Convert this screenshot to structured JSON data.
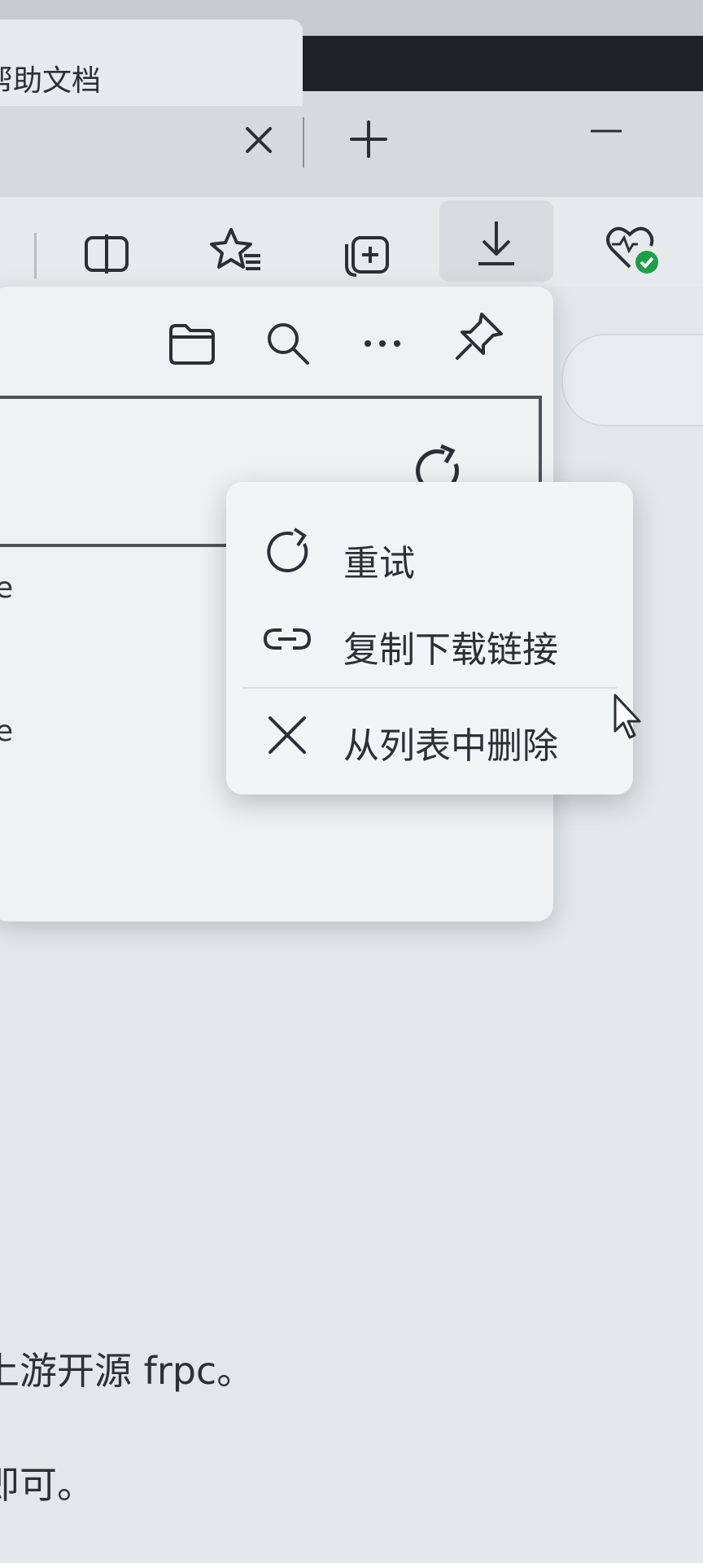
{
  "tab": {
    "title": "帮助文档"
  },
  "toolbar": {
    "icons": [
      "split-screen-icon",
      "favorites-icon",
      "collections-icon",
      "downloads-icon",
      "browser-essentials-icon"
    ]
  },
  "downloads_panel": {
    "header_icons": [
      "folder-icon",
      "search-icon",
      "more-icon",
      "pin-icon"
    ],
    "item_fragment_1": "e",
    "item_fragment_2": "e"
  },
  "context_menu": {
    "items": [
      {
        "label": "重试",
        "icon": "retry-icon"
      },
      {
        "label": "复制下载链接",
        "icon": "link-icon"
      },
      {
        "label": "从列表中删除",
        "icon": "close-icon"
      }
    ]
  },
  "page": {
    "line1": "上游开源 frpc。",
    "line2": "即可。"
  },
  "colors": {
    "health_badge": "#1e9e4a"
  }
}
